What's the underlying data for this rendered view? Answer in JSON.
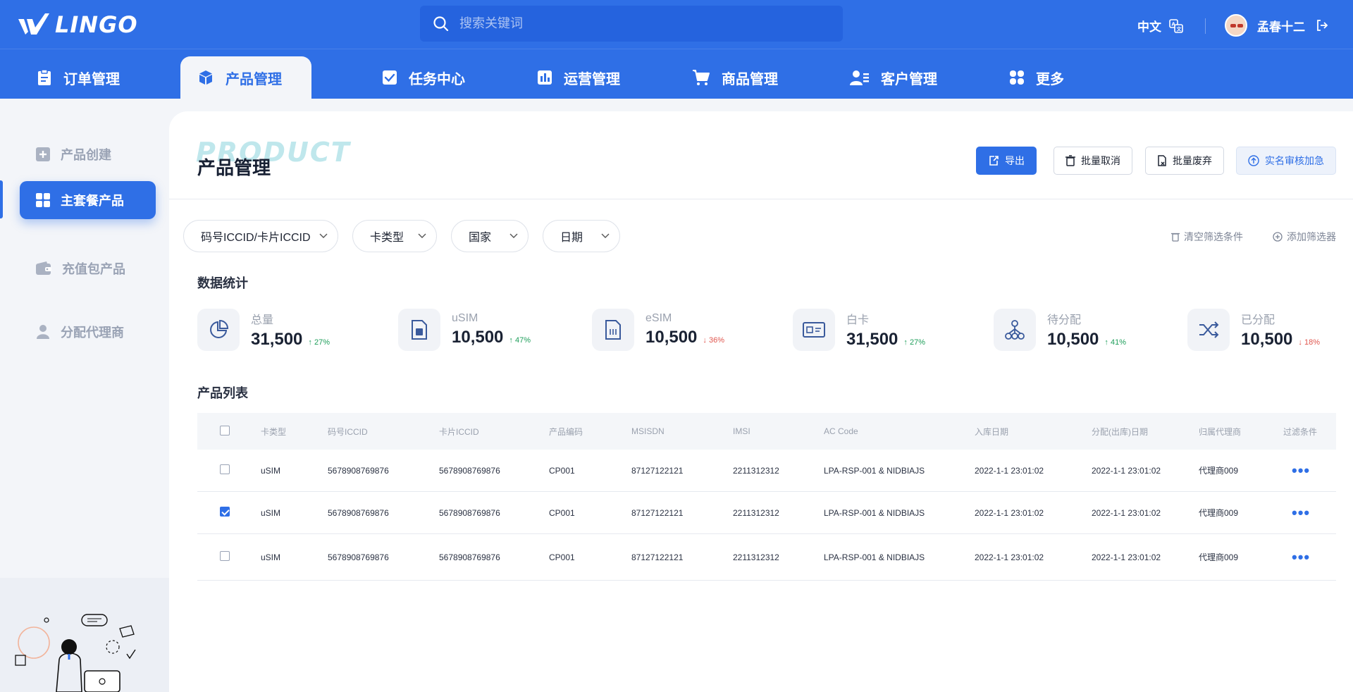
{
  "brand": {
    "name": "LINGO"
  },
  "search": {
    "placeholder": "搜索关键词"
  },
  "header": {
    "language": "中文",
    "user_name": "孟春十二"
  },
  "nav_tabs": [
    {
      "label": "订单管理",
      "icon": "clipboard-icon"
    },
    {
      "label": "产品管理",
      "icon": "cube-icon",
      "active": true
    },
    {
      "label": "任务中心",
      "icon": "checkbox-icon"
    },
    {
      "label": "运营管理",
      "icon": "bar-chart-icon"
    },
    {
      "label": "商品管理",
      "icon": "cart-icon"
    },
    {
      "label": "客户管理",
      "icon": "users-icon"
    },
    {
      "label": "更多",
      "icon": "grid-icon"
    }
  ],
  "sidebar": {
    "items": [
      {
        "label": "产品创建",
        "icon": "plus-square-icon"
      },
      {
        "label": "主套餐产品",
        "icon": "grid-icon",
        "active": true
      },
      {
        "label": "充值包产品",
        "icon": "wallet-icon"
      },
      {
        "label": "分配代理商",
        "icon": "person-icon"
      }
    ]
  },
  "page": {
    "watermark": "PRODUCT",
    "title": "产品管理",
    "actions": {
      "export": "导出",
      "batch_cancel": "批量取消",
      "batch_discard": "批量废弃",
      "realname_review": "实名审核加急"
    }
  },
  "filters": {
    "chips": [
      "码号ICCID/卡片ICCID",
      "卡类型",
      "国家",
      "日期"
    ],
    "clear": "清空筛选条件",
    "add": "添加筛选器"
  },
  "stats": {
    "title": "数据统计",
    "items": [
      {
        "label": "总量",
        "value": "31,500",
        "delta": "27%",
        "direction": "up",
        "icon": "pie-chart-icon"
      },
      {
        "label": "uSIM",
        "value": "10,500",
        "delta": "47%",
        "direction": "up",
        "icon": "sim-card-icon"
      },
      {
        "label": "eSIM",
        "value": "10,500",
        "delta": "36%",
        "direction": "down",
        "icon": "esim-icon"
      },
      {
        "label": "白卡",
        "value": "31,500",
        "delta": "27%",
        "direction": "up",
        "icon": "id-card-icon"
      },
      {
        "label": "待分配",
        "value": "10,500",
        "delta": "41%",
        "direction": "up",
        "icon": "hierarchy-icon"
      },
      {
        "label": "已分配",
        "value": "10,500",
        "delta": "18%",
        "direction": "down",
        "icon": "shuffle-icon"
      }
    ]
  },
  "table": {
    "title": "产品列表",
    "columns": [
      "卡类型",
      "码号ICCID",
      "卡片ICCID",
      "产品编码",
      "MSISDN",
      "IMSI",
      "AC Code",
      "入库日期",
      "分配(出库)日期",
      "归属代理商",
      "过滤条件"
    ],
    "rows": [
      {
        "checked": false,
        "cells": [
          "uSIM",
          "5678908769876",
          "5678908769876",
          "CP001",
          "87127122121",
          "2211312312",
          "LPA-RSP-001 & NIDBIAJS",
          "2022-1-1 23:01:02",
          "2022-1-1 23:01:02",
          "代理商009"
        ]
      },
      {
        "checked": true,
        "cells": [
          "uSIM",
          "5678908769876",
          "5678908769876",
          "CP001",
          "87127122121",
          "2211312312",
          "LPA-RSP-001 & NIDBIAJS",
          "2022-1-1 23:01:02",
          "2022-1-1 23:01:02",
          "代理商009"
        ]
      },
      {
        "checked": false,
        "cells": [
          "uSIM",
          "5678908769876",
          "5678908769876",
          "CP001",
          "87127122121",
          "2211312312",
          "LPA-RSP-001 & NIDBIAJS",
          "2022-1-1 23:01:02",
          "2022-1-1 23:01:02",
          "代理商009"
        ]
      }
    ],
    "row_action": "•••"
  },
  "colors": {
    "primary": "#2f6fe6",
    "up": "#1e9e5a",
    "down": "#e0564e"
  }
}
